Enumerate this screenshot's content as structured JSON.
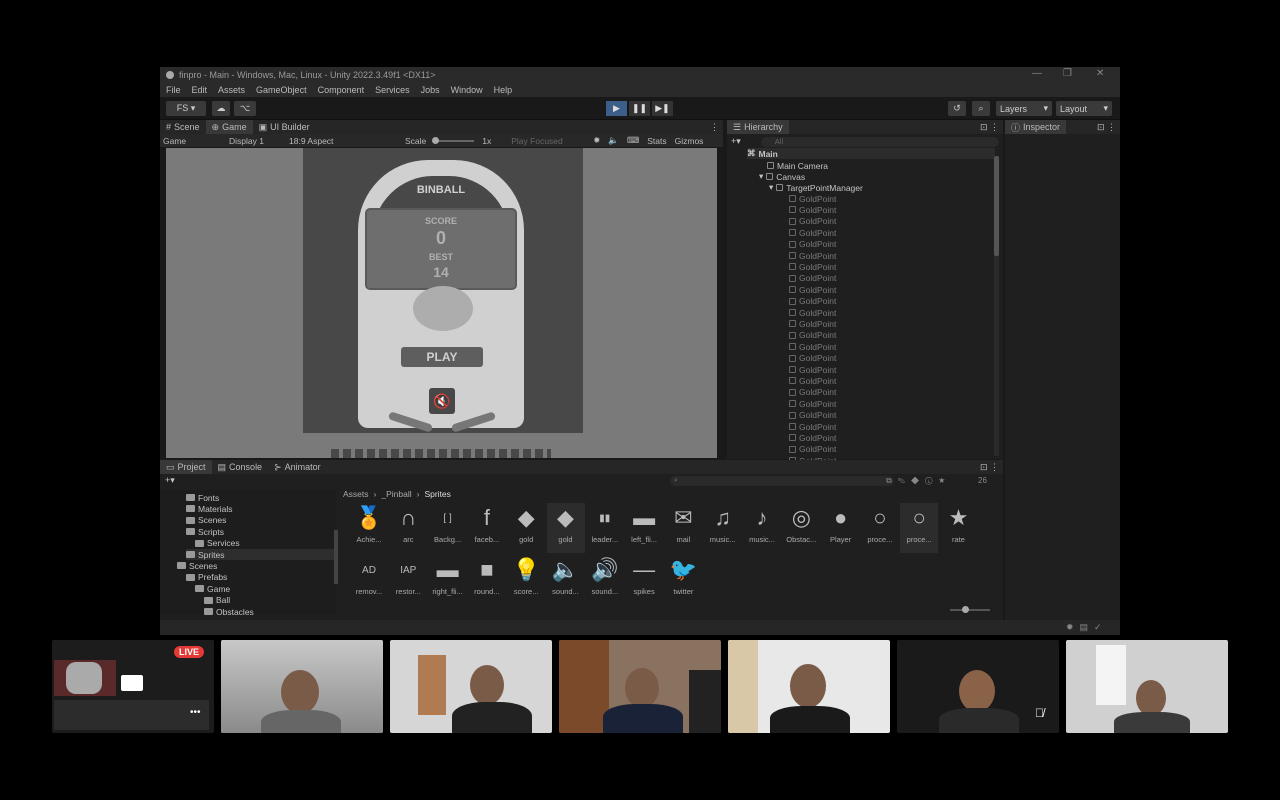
{
  "window": {
    "title": "finpro - Main - Windows, Mac, Linux - Unity 2022.3.49f1 <DX11>",
    "min": "—",
    "max": "❐",
    "close": "✕"
  },
  "menu": [
    "File",
    "Edit",
    "Assets",
    "GameObject",
    "Component",
    "Services",
    "Jobs",
    "Window",
    "Help"
  ],
  "toolbar": {
    "account": "FS ▾",
    "layers": "Layers",
    "layout": "Layout"
  },
  "scene_tabs": {
    "scene": "Scene",
    "game": "Game",
    "ui_builder": "UI Builder"
  },
  "gamebar": {
    "mode": "Game",
    "display": "Display 1",
    "aspect": "18:9 Aspect",
    "scale_label": "Scale",
    "scale_value": "1x",
    "play_focused": "Play Focused",
    "stats": "Stats",
    "gizmos": "Gizmos"
  },
  "game": {
    "title": "BINBALL",
    "score_label": "SCORE",
    "score": "0",
    "best_label": "BEST",
    "best": "14",
    "play": "PLAY"
  },
  "hierarchy": {
    "title": "Hierarchy",
    "search": "All",
    "root": "Main",
    "camera": "Main Camera",
    "canvas": "Canvas",
    "manager": "TargetPointManager",
    "points": [
      "GoldPoint",
      "GoldPoint",
      "GoldPoint",
      "GoldPoint",
      "GoldPoint",
      "GoldPoint",
      "GoldPoint",
      "GoldPoint",
      "GoldPoint",
      "GoldPoint",
      "GoldPoint",
      "GoldPoint",
      "GoldPoint",
      "GoldPoint",
      "GoldPoint",
      "GoldPoint",
      "GoldPoint",
      "GoldPoint",
      "GoldPoint",
      "GoldPoint",
      "GoldPoint",
      "GoldPoint",
      "GoldPoint",
      "GoldPoint",
      "GoldPoint",
      "GoldPoint"
    ]
  },
  "inspector": {
    "title": "Inspector"
  },
  "project_tabs": {
    "project": "Project",
    "console": "Console",
    "animator": "Animator"
  },
  "project_count": "26",
  "breadcrumb": [
    "Assets",
    "_Pinball",
    "Sprites"
  ],
  "tree": [
    {
      "label": "Fonts",
      "depth": 2
    },
    {
      "label": "Materials",
      "depth": 2
    },
    {
      "label": "Scenes",
      "depth": 2
    },
    {
      "label": "Scripts",
      "depth": 2
    },
    {
      "label": "Services",
      "depth": 3
    },
    {
      "label": "Sprites",
      "depth": 2
    },
    {
      "label": "Scenes",
      "depth": 1
    },
    {
      "label": "Prefabs",
      "depth": 2
    },
    {
      "label": "Game",
      "depth": 3
    },
    {
      "label": "Ball",
      "depth": 4
    },
    {
      "label": "Obstacles",
      "depth": 4
    }
  ],
  "assets_row1": [
    {
      "label": "Achie...",
      "glyph": "🏅"
    },
    {
      "label": "arc",
      "glyph": "∩"
    },
    {
      "label": "Backg...",
      "glyph": "[ ]"
    },
    {
      "label": "faceb...",
      "glyph": "f"
    },
    {
      "label": "gold",
      "glyph": "◆"
    },
    {
      "label": "gold",
      "glyph": "◆"
    },
    {
      "label": "leader...",
      "glyph": "▮▮"
    },
    {
      "label": "left_fli...",
      "glyph": "▬"
    },
    {
      "label": "mail",
      "glyph": "✉"
    },
    {
      "label": "music...",
      "glyph": "♫"
    },
    {
      "label": "music...",
      "glyph": "♪"
    },
    {
      "label": "Obstac...",
      "glyph": "◎"
    },
    {
      "label": "Player",
      "glyph": "●"
    },
    {
      "label": "proce...",
      "glyph": "○"
    },
    {
      "label": "proce...",
      "glyph": "○"
    },
    {
      "label": "rate",
      "glyph": "★"
    }
  ],
  "assets_row2": [
    {
      "label": "remov...",
      "glyph": "AD"
    },
    {
      "label": "restor...",
      "glyph": "IAP"
    },
    {
      "label": "right_fli...",
      "glyph": "▬"
    },
    {
      "label": "round...",
      "glyph": "■"
    },
    {
      "label": "score...",
      "glyph": "💡"
    },
    {
      "label": "sound...",
      "glyph": "🔈"
    },
    {
      "label": "sound...",
      "glyph": "🔊"
    },
    {
      "label": "spikes",
      "glyph": "—"
    },
    {
      "label": "twitter",
      "glyph": "🐦"
    }
  ],
  "meet": {
    "live": "LIVE",
    "more": "•••"
  }
}
